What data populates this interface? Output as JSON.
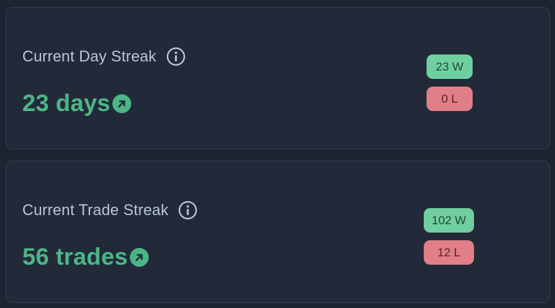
{
  "cards": [
    {
      "title": "Current Day Streak",
      "value": "23 days",
      "wins": "23 W",
      "losses": "0 L"
    },
    {
      "title": "Current Trade Streak",
      "value": "56 trades",
      "wins": "102 W",
      "losses": "12 L"
    }
  ],
  "icons": {
    "info": "info-circle-icon",
    "trend": "arrow-up-right-circle-icon"
  },
  "colors": {
    "background": "#1c2331",
    "card": "#222a3a",
    "accent_green": "#4db585",
    "win_badge": "#6fcf9f",
    "loss_badge": "#e07f87"
  }
}
